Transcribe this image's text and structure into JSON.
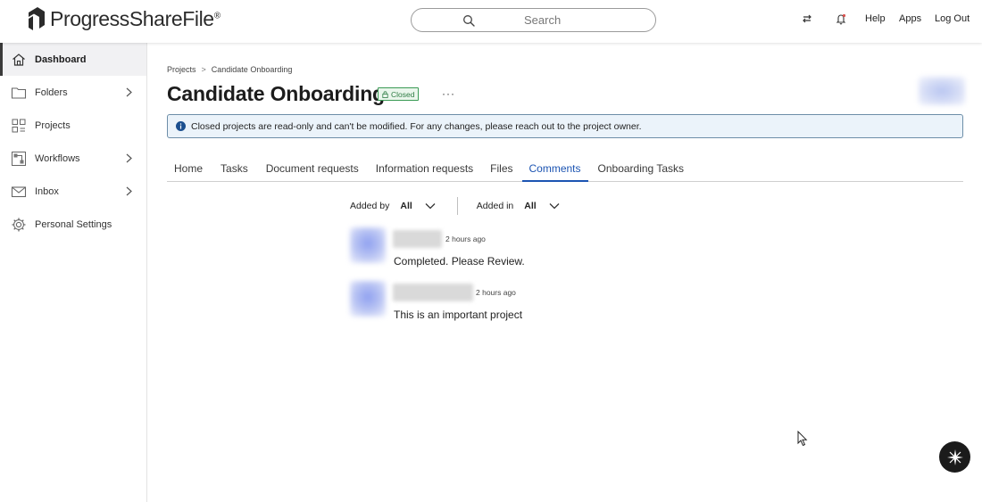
{
  "header": {
    "logo_prefix": "Progress",
    "logo_product": "ShareFile",
    "logo_mark": "®",
    "search_placeholder": "Search",
    "links": {
      "help": "Help",
      "apps": "Apps",
      "logout": "Log Out"
    },
    "icons": {
      "switch": "swap-arrows-icon",
      "notifications": "bell-icon"
    }
  },
  "sidebar": {
    "items": [
      {
        "label": "Dashboard",
        "icon": "home-icon",
        "active": true,
        "expandable": false
      },
      {
        "label": "Folders",
        "icon": "folder-icon",
        "active": false,
        "expandable": true
      },
      {
        "label": "Projects",
        "icon": "projects-icon",
        "active": false,
        "expandable": false
      },
      {
        "label": "Workflows",
        "icon": "workflows-icon",
        "active": false,
        "expandable": true
      },
      {
        "label": "Inbox",
        "icon": "envelope-icon",
        "active": false,
        "expandable": true
      },
      {
        "label": "Personal Settings",
        "icon": "gear-icon",
        "active": false,
        "expandable": false
      }
    ]
  },
  "main": {
    "breadcrumb": {
      "root": "Projects",
      "separator": ">",
      "current": "Candidate Onboarding"
    },
    "title": "Candidate Onboarding",
    "status_badge": "Closed",
    "more_menu": "···",
    "banner": "Closed projects are read-only and can't be modified. For any changes, please reach out to the project owner.",
    "tabs": [
      {
        "label": "Home",
        "active": false
      },
      {
        "label": "Tasks",
        "active": false
      },
      {
        "label": "Document requests",
        "active": false
      },
      {
        "label": "Information requests",
        "active": false
      },
      {
        "label": "Files",
        "active": false
      },
      {
        "label": "Comments",
        "active": true
      },
      {
        "label": "Onboarding Tasks",
        "active": false
      }
    ],
    "filters": {
      "added_by_label": "Added by",
      "added_by_value": "All",
      "added_in_label": "Added in",
      "added_in_value": "All"
    },
    "comments": [
      {
        "time": "2 hours ago",
        "text": "Completed. Please Review."
      },
      {
        "time": "2 hours ago",
        "text": "This is an important project"
      }
    ]
  },
  "colors": {
    "accent": "#1c54b2",
    "badge_green": "#3a9a55",
    "banner_bg": "#ebf3fa",
    "banner_border": "#6d8ea8",
    "info_icon": "#1b4f8f"
  }
}
